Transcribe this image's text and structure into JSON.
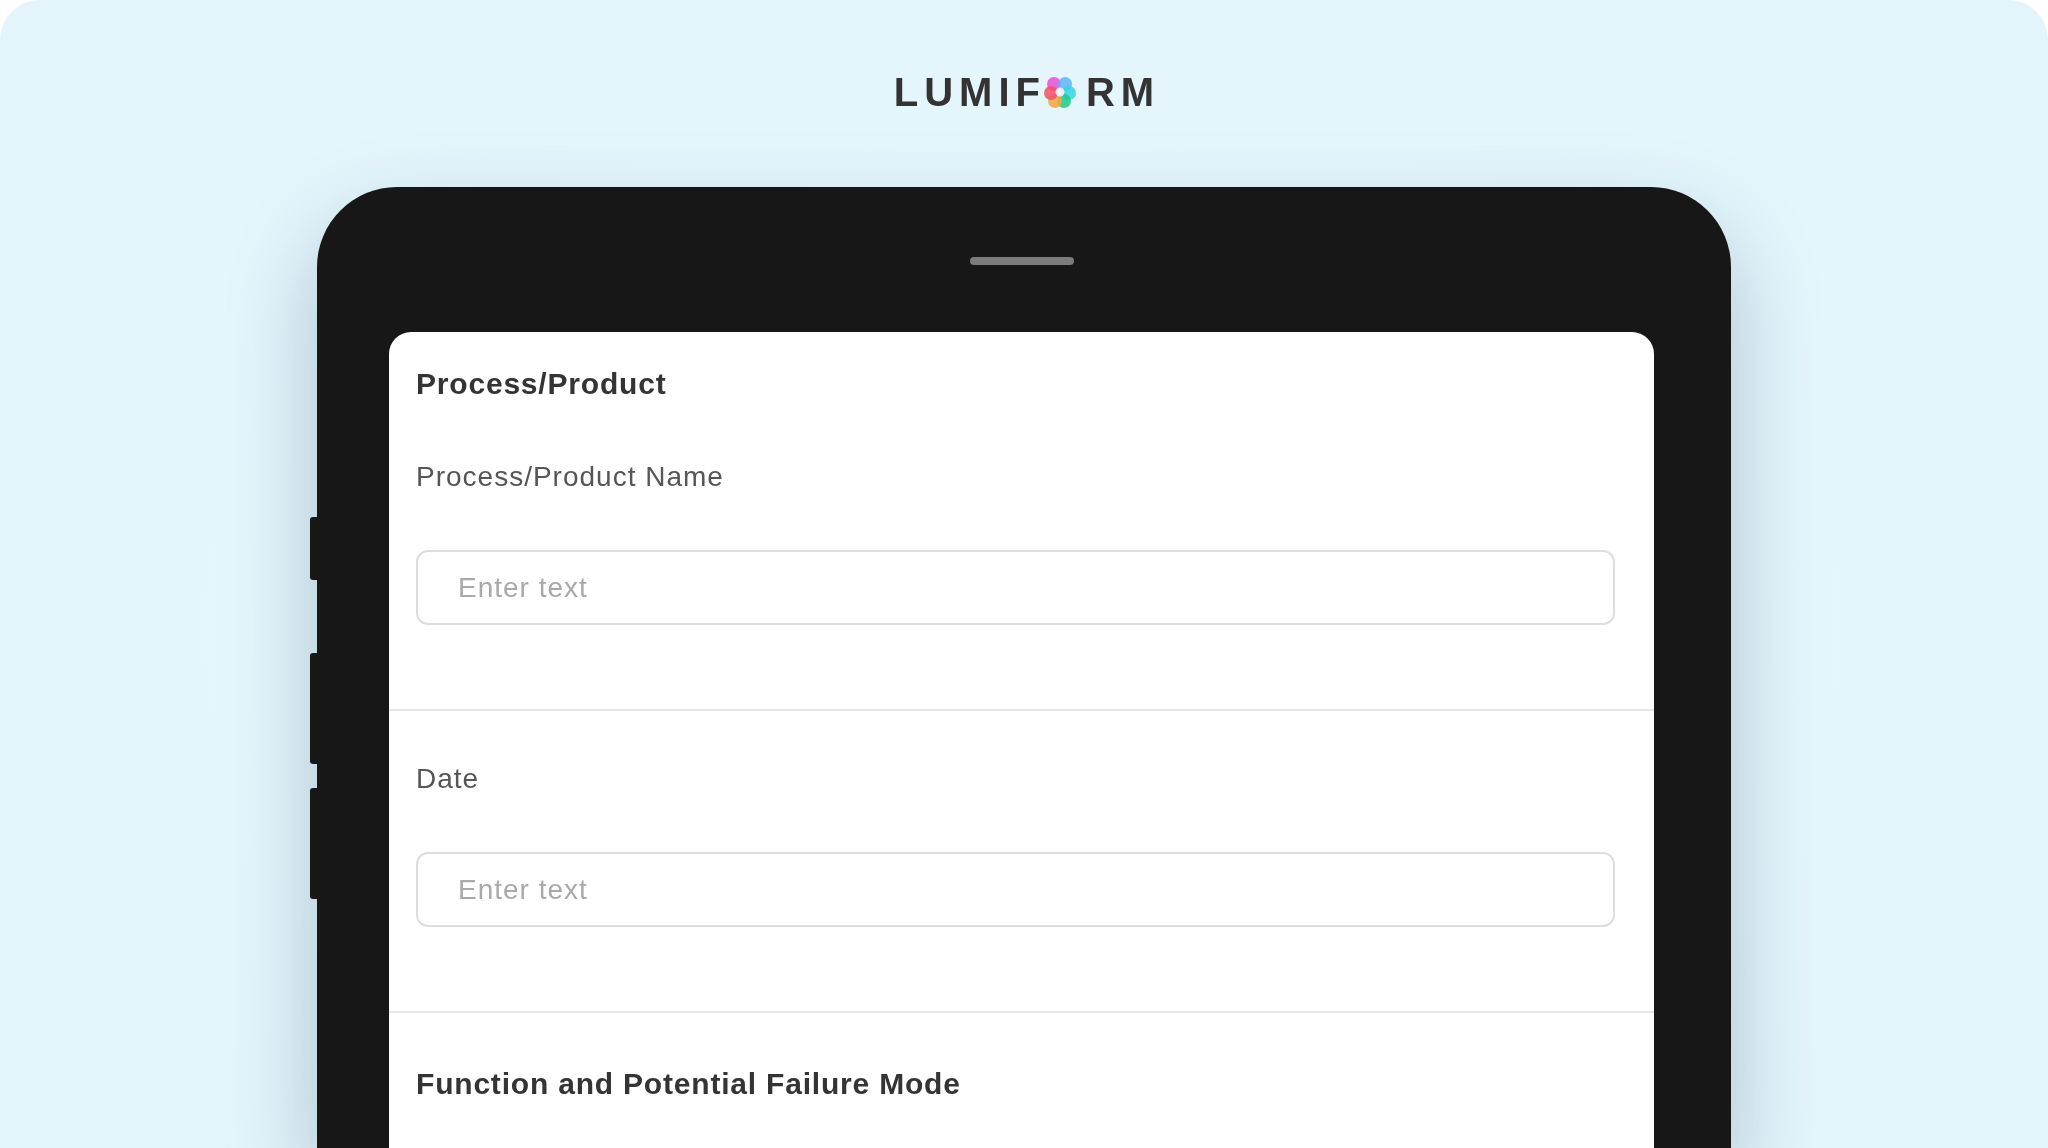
{
  "brand": {
    "logo_text_before": "LUMIF",
    "logo_text_after": "RM"
  },
  "form": {
    "sections": [
      {
        "kind": "header",
        "title": "Process/Product"
      },
      {
        "kind": "field",
        "label": "Process/Product Name",
        "placeholder": "Enter text"
      },
      {
        "kind": "field",
        "label": "Date",
        "placeholder": "Enter text"
      },
      {
        "kind": "header",
        "title": "Function and Potential Failure Mode"
      }
    ]
  }
}
